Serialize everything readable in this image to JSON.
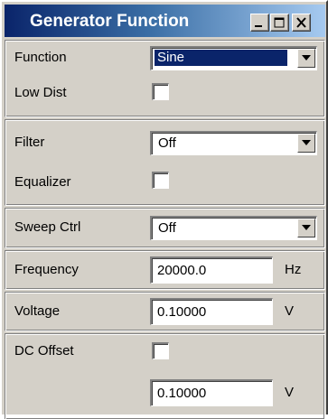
{
  "window": {
    "title": "Generator Function",
    "colors": {
      "titlebar_start": "#0a246a",
      "titlebar_end": "#a6caf0",
      "face": "#d4d0c8"
    },
    "icons": {
      "minimize": "minimize-icon",
      "maximize": "maximize-icon",
      "close": "close-icon"
    }
  },
  "function": {
    "label": "Function",
    "value": "Sine",
    "selected": true
  },
  "low_dist": {
    "label": "Low Dist",
    "checked": false
  },
  "filter": {
    "label": "Filter",
    "value": "Off"
  },
  "equalizer": {
    "label": "Equalizer",
    "checked": false
  },
  "sweep_ctrl": {
    "label": "Sweep Ctrl",
    "value": "Off"
  },
  "frequency": {
    "label": "Frequency",
    "value": "20000.0",
    "unit": "Hz"
  },
  "voltage": {
    "label": "Voltage",
    "value": "0.10000",
    "unit": "V"
  },
  "dc_offset": {
    "label": "DC Offset",
    "checked": false,
    "value": "0.10000",
    "unit": "V"
  }
}
